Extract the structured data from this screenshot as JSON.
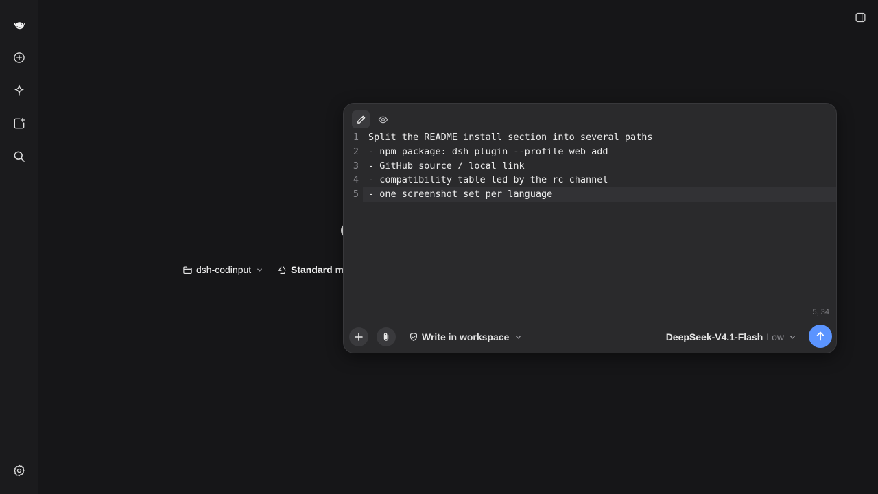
{
  "sidebar": {
    "logo_icon": "whale-logo-icon",
    "items": [
      {
        "icon": "new-chat-icon"
      },
      {
        "icon": "sparkle-icon"
      },
      {
        "icon": "add-square-icon"
      },
      {
        "icon": "search-icon"
      }
    ],
    "settings_icon": "gear-icon"
  },
  "topbar": {
    "panel_icon": "sidebar-panel-icon"
  },
  "background": {
    "project_label": "dsh-codinput",
    "mode_label": "Standard mode"
  },
  "editor": {
    "toolbar": {
      "edit_icon": "pencil-icon",
      "preview_icon": "eye-icon"
    },
    "lines": [
      {
        "n": "1",
        "text": "Split the README install section into several paths"
      },
      {
        "n": "2",
        "text": "- npm package: dsh plugin --profile web add"
      },
      {
        "n": "3",
        "text": "- GitHub source / local link"
      },
      {
        "n": "4",
        "text": "- compatibility table led by the rc channel"
      },
      {
        "n": "5",
        "text": "- one screenshot set per language"
      }
    ],
    "cursor_position": "5, 34",
    "workspace_label": "Write in workspace",
    "model_name": "DeepSeek-V4.1-Flash",
    "model_effort": "Low"
  },
  "colors": {
    "background": "#161618",
    "card": "#2a2a2c",
    "accent": "#5b94ff"
  }
}
